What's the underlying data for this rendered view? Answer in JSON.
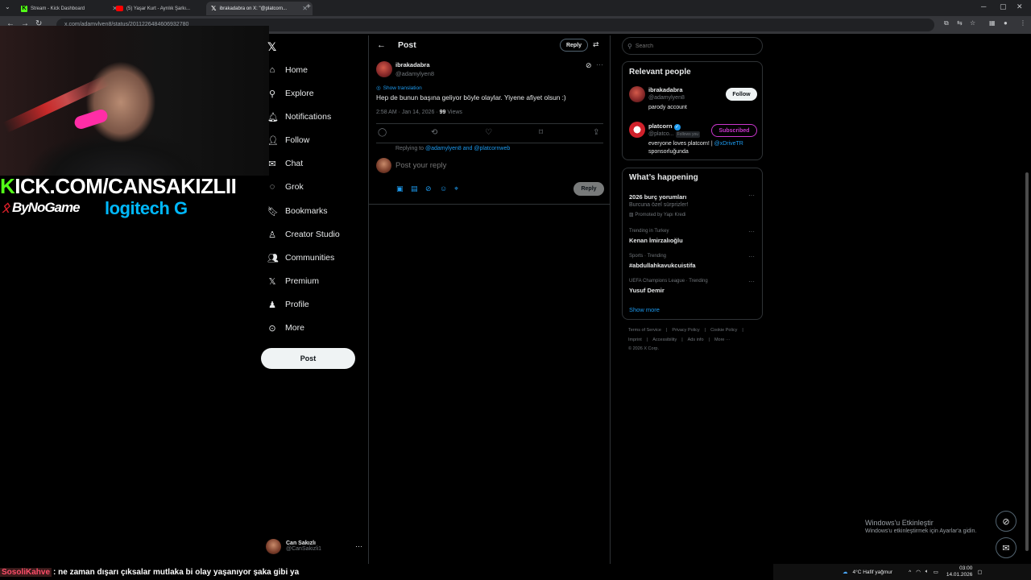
{
  "browser": {
    "tabs": [
      {
        "label": "Stream - Kick Dashboard",
        "active": false
      },
      {
        "label": "(5) Yaşar Kurt - Ayrılık Şarkı...",
        "active": false
      },
      {
        "label": "ibrakadabra on X: \"@platcorn...",
        "active": true
      }
    ],
    "url": "x.com/adamylyen8/status/2011226484606932780"
  },
  "stream_overlay": {
    "kick_url_prefix": "K",
    "kick_url_rest": "ICK.COM/CANSAKIZLII",
    "sponsor_bynogame": "ByNoGame",
    "sponsor_logitech": "logitech G"
  },
  "nav": {
    "items": [
      {
        "label": "Home",
        "icon": "home-icon"
      },
      {
        "label": "Explore",
        "icon": "search-icon"
      },
      {
        "label": "Notifications",
        "icon": "bell-icon"
      },
      {
        "label": "Follow",
        "icon": "add-user-icon"
      },
      {
        "label": "Chat",
        "icon": "chat-icon"
      },
      {
        "label": "Grok",
        "icon": "grok-icon"
      },
      {
        "label": "Bookmarks",
        "icon": "bookmark-icon"
      },
      {
        "label": "Creator Studio",
        "icon": "creator-icon"
      },
      {
        "label": "Communities",
        "icon": "communities-icon"
      },
      {
        "label": "Premium",
        "icon": "x-icon"
      },
      {
        "label": "Profile",
        "icon": "person-icon"
      },
      {
        "label": "More",
        "icon": "more-circle-icon"
      }
    ],
    "post_button": "Post",
    "account": {
      "name": "Can Sakızlı",
      "handle": "@CanSakizli1"
    }
  },
  "post": {
    "header_title": "Post",
    "reply_button": "Reply",
    "author_name": "ibrakadabra",
    "author_handle": "@adamylyen8",
    "show_translation": "Show translation",
    "text": "Hep de bunun başına geliyor böyle olaylar. Yiyene afiyet olsun :)",
    "time": "2:58 AM · Jan 14, 2026 · ",
    "views_count": "99",
    "views_label": " Views",
    "replying_prefix": "Replying to ",
    "replying_users": "@adamylyen8 and @platcornweb",
    "reply_placeholder": "Post your reply",
    "reply_submit": "Reply"
  },
  "sidebar": {
    "search_placeholder": "Search",
    "relevant_title": "Relevant people",
    "people": [
      {
        "name": "ibrakadabra",
        "handle": "@adamylyen8",
        "bio": "parody account",
        "button": "Follow"
      },
      {
        "name": "platcorn",
        "handle": "@platco...",
        "follows_you": "Follows you",
        "bio_text": "everyone loves platcorn! | ",
        "bio_link": "@xDriveTR",
        "bio_text2": "sponsorluğunda",
        "button": "Subscribed"
      }
    ],
    "happening_title": "What’s happening",
    "trends": [
      {
        "context": "",
        "name": "2026 burç yorumları",
        "sub": "Burcuna özel sürprizler!",
        "promo": "Promoted by Yapı Kredi"
      },
      {
        "context": "Trending in Turkey",
        "name": "Kenan İmirzalıoğlu"
      },
      {
        "context": "Sports · Trending",
        "name": "#abdullahkavukcuistifa"
      },
      {
        "context": "UEFA Champions League · Trending",
        "name": "Yusuf Demir"
      }
    ],
    "show_more": "Show more",
    "footer": [
      "Terms of Service",
      "Privacy Policy",
      "Cookie Policy",
      "Imprint",
      "Accessibility",
      "Ads info",
      "More ···",
      "© 2026 X Corp."
    ]
  },
  "chat_overlay": {
    "user": "SosoliKahve",
    "message": ": ne zaman dışarı çıksalar mutlaka bi olay yaşanıyor şaka gibi ya"
  },
  "windows": {
    "activate_title": "Windows'u Etkinleştir",
    "activate_sub": "Windows'u etkinleştirmek için Ayarlar'a gidin.",
    "weather": "4°C  Hafif yağmur",
    "time": "03:00",
    "date": "14.01.2026"
  }
}
